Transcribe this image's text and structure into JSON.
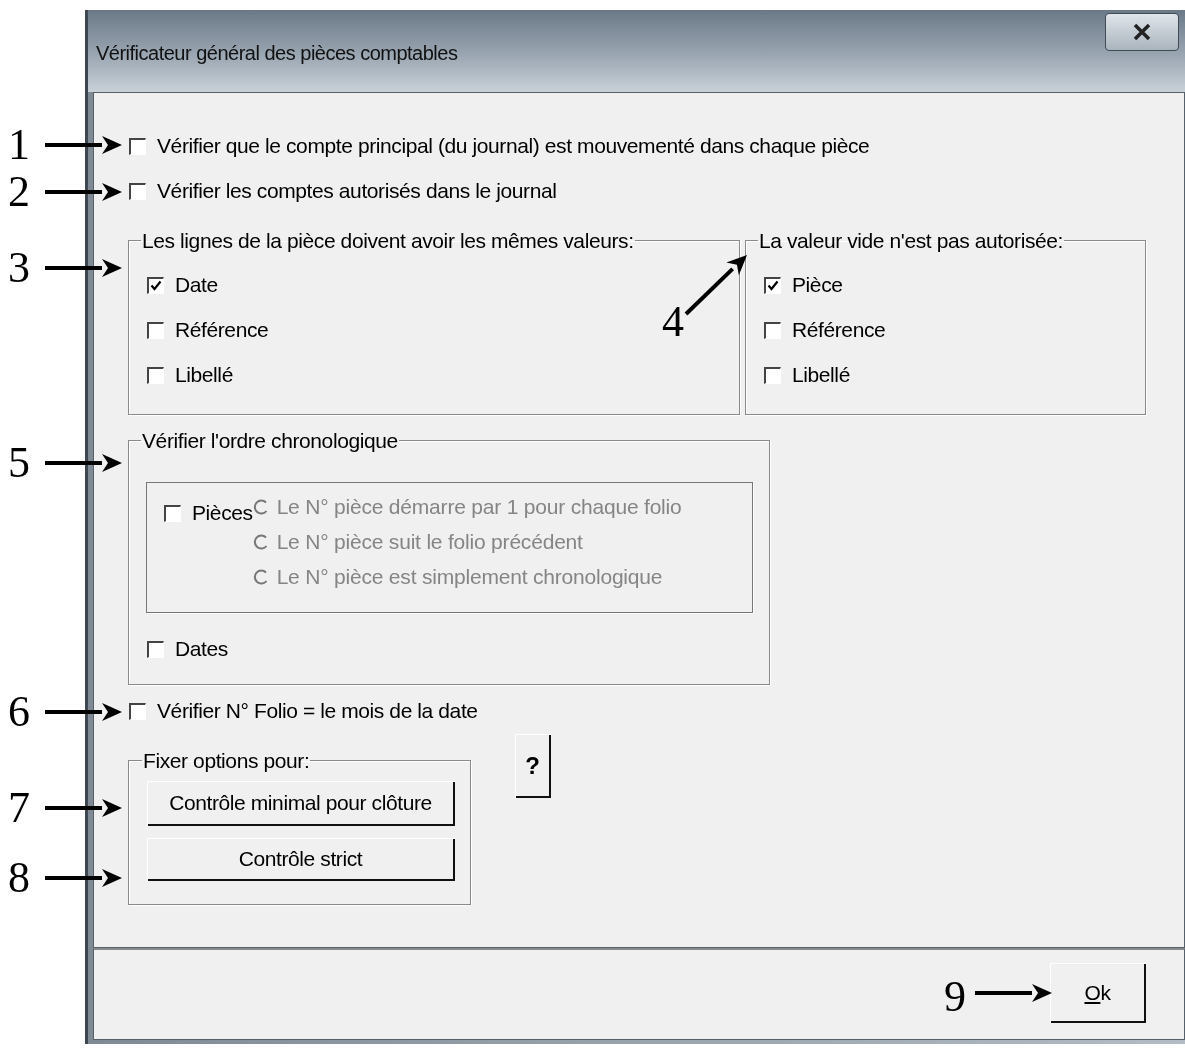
{
  "window": {
    "title": "Vérificateur général des pièces comptables"
  },
  "options": [
    {
      "label": "Vérifier que le compte principal (du journal) est mouvementé dans chaque pièce",
      "checked": false
    },
    {
      "label": "Vérifier les comptes autorisés dans le journal",
      "checked": false
    }
  ],
  "same_values_group": {
    "legend": "Les lignes de la pièce doivent avoir les mêmes valeurs:",
    "items": [
      {
        "label": "Date",
        "checked": true
      },
      {
        "label": "Référence",
        "checked": false
      },
      {
        "label": "Libellé",
        "checked": false
      }
    ]
  },
  "empty_value_group": {
    "legend": "La valeur vide n'est pas autorisée:",
    "items": [
      {
        "label": "Pièce",
        "checked": true
      },
      {
        "label": "Référence",
        "checked": false
      },
      {
        "label": "Libellé",
        "checked": false
      }
    ]
  },
  "chronology_group": {
    "legend": "Vérifier l'ordre chronologique",
    "pieces": {
      "label": "Pièces",
      "checked": false
    },
    "numbering": [
      {
        "label": "Le N° pièce démarre par 1 pour chaque folio",
        "selected": false,
        "disabled": true
      },
      {
        "label": "Le N° pièce suit le folio précédent",
        "selected": false,
        "disabled": true
      },
      {
        "label": "Le N° pièce est simplement chronologique",
        "selected": false,
        "disabled": true
      }
    ],
    "dates": {
      "label": "Dates",
      "checked": false
    }
  },
  "folio_option": {
    "label": "Vérifier N° Folio = le mois de la date",
    "checked": false
  },
  "presets_group": {
    "legend": "Fixer options pour:",
    "buttons": [
      "Contrôle minimal pour clôture",
      "Contrôle strict"
    ]
  },
  "help_button": "?",
  "ok_button": "Ok",
  "callouts": [
    {
      "number": "1"
    },
    {
      "number": "2"
    },
    {
      "number": "3"
    },
    {
      "number": "4"
    },
    {
      "number": "5"
    },
    {
      "number": "6"
    },
    {
      "number": "7"
    },
    {
      "number": "8"
    },
    {
      "number": "9"
    }
  ]
}
